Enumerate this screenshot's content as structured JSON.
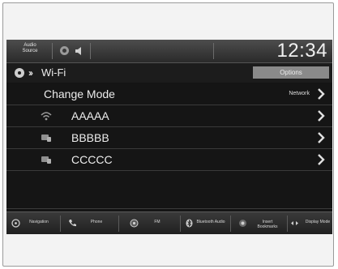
{
  "status_bar": {
    "audio_source": "Audio Source",
    "clock": "12:34",
    "icons": [
      "camera-icon",
      "speaker-icon"
    ]
  },
  "header": {
    "title": "Wi-Fi",
    "options_label": "Options"
  },
  "list": {
    "change_mode": {
      "label": "Change Mode",
      "value": "Network"
    },
    "networks": [
      {
        "name": "AAAAA",
        "icon": "wifi-icon"
      },
      {
        "name": "BBBBB",
        "icon": "device-icon"
      },
      {
        "name": "CCCCC",
        "icon": "device-icon"
      }
    ]
  },
  "bottom_nav": {
    "items": [
      {
        "label": "Navigation",
        "icon": "navigation-icon"
      },
      {
        "label": "Phone",
        "icon": "phone-icon"
      },
      {
        "label": "FM",
        "icon": "radio-icon"
      },
      {
        "label": "Bluetooth Audio",
        "icon": "bluetooth-icon"
      },
      {
        "label": "Insert Bookmarks",
        "icon": "bookmark-icon"
      },
      {
        "label": "Display Mode",
        "icon": "display-mode-icon"
      }
    ]
  },
  "colors": {
    "screen_bg": "#141414",
    "status_bar_bg": "#3a3a3a",
    "options_bg": "#8a8a8a",
    "text": "#ececec"
  }
}
